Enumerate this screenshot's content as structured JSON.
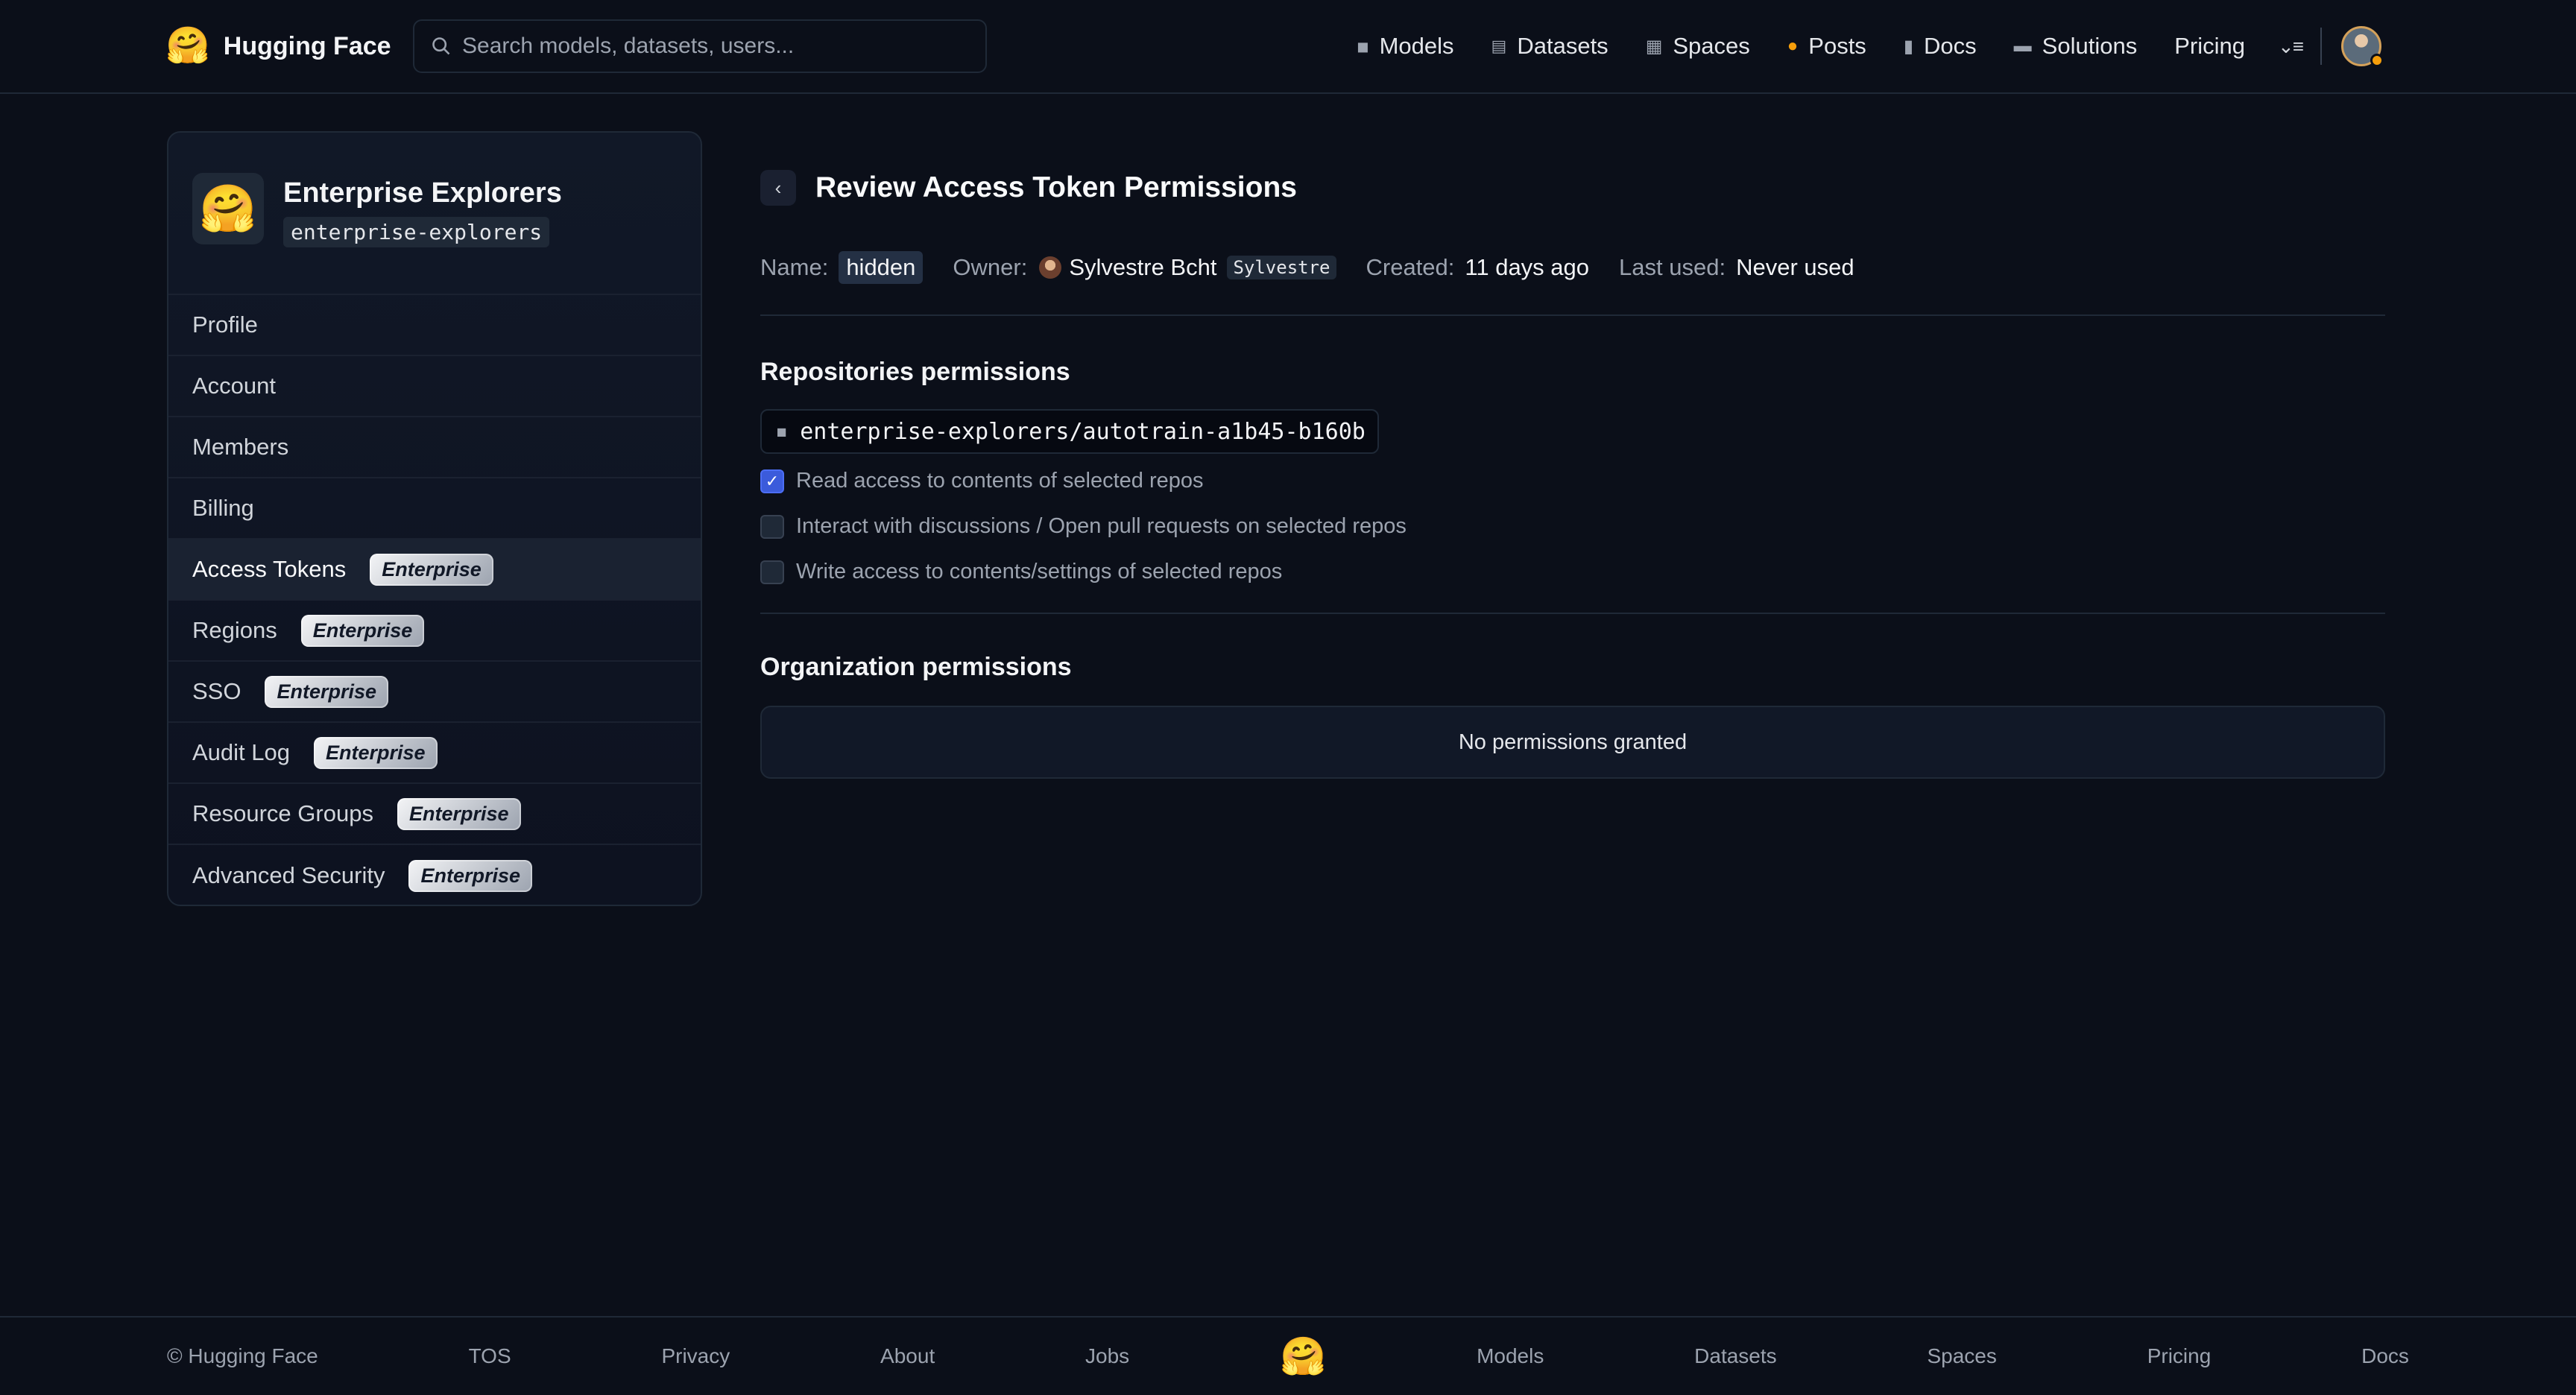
{
  "header": {
    "brand": "Hugging Face",
    "logo_emoji": "🤗",
    "search_placeholder": "Search models, datasets, users...",
    "nav": [
      {
        "label": "Models",
        "icon": "cube-icon",
        "glyph": "◼",
        "color": "#9ca3af"
      },
      {
        "label": "Datasets",
        "icon": "database-icon",
        "glyph": "▤",
        "color": "#9ca3af"
      },
      {
        "label": "Spaces",
        "icon": "grid-icon",
        "glyph": "▦",
        "color": "#9ca3af"
      },
      {
        "label": "Posts",
        "icon": "chat-bubble-icon",
        "glyph": "●",
        "color": "#f59e0b"
      },
      {
        "label": "Docs",
        "icon": "book-icon",
        "glyph": "▮",
        "color": "#9ca3af"
      },
      {
        "label": "Solutions",
        "icon": "briefcase-icon",
        "glyph": "▬",
        "color": "#9ca3af"
      },
      {
        "label": "Pricing",
        "icon": "",
        "glyph": "",
        "color": ""
      }
    ],
    "more_menu": "⌄≡"
  },
  "sidebar": {
    "org_name": "Enterprise Explorers",
    "org_slug": "enterprise-explorers",
    "org_emoji": "🤗",
    "items": [
      {
        "label": "Profile",
        "badge": ""
      },
      {
        "label": "Account",
        "badge": ""
      },
      {
        "label": "Members",
        "badge": ""
      },
      {
        "label": "Billing",
        "badge": ""
      },
      {
        "label": "Access Tokens",
        "badge": "Enterprise",
        "active": true
      },
      {
        "label": "Regions",
        "badge": "Enterprise"
      },
      {
        "label": "SSO",
        "badge": "Enterprise"
      },
      {
        "label": "Audit Log",
        "badge": "Enterprise"
      },
      {
        "label": "Resource Groups",
        "badge": "Enterprise"
      },
      {
        "label": "Advanced Security",
        "badge": "Enterprise"
      }
    ]
  },
  "main": {
    "back_glyph": "‹",
    "title": "Review Access Token Permissions",
    "meta": {
      "name_label": "Name:",
      "name_value": "hidden",
      "owner_label": "Owner:",
      "owner_name": "Sylvestre Bcht",
      "owner_user": "Sylvestre",
      "created_label": "Created:",
      "created_value": "11 days ago",
      "last_used_label": "Last used:",
      "last_used_value": "Never used"
    },
    "repo_section_title": "Repositories permissions",
    "repo_name": "enterprise-explorers/autotrain-a1b45-b160b",
    "repo_permissions": [
      {
        "label": "Read access to contents of selected repos",
        "checked": true
      },
      {
        "label": "Interact with discussions / Open pull requests on selected repos",
        "checked": false
      },
      {
        "label": "Write access to contents/settings of selected repos",
        "checked": false
      }
    ],
    "org_section_title": "Organization permissions",
    "org_permissions_empty": "No permissions granted"
  },
  "footer": {
    "copyright": "© Hugging Face",
    "links": [
      "TOS",
      "Privacy",
      "About",
      "Jobs",
      "Models",
      "Datasets",
      "Spaces",
      "Pricing",
      "Docs"
    ],
    "logo_emoji": "🤗"
  },
  "colors": {
    "background": "#0b0f19",
    "checkbox_checked": "#3b5bdb",
    "accent_orange": "#f59e0b"
  }
}
